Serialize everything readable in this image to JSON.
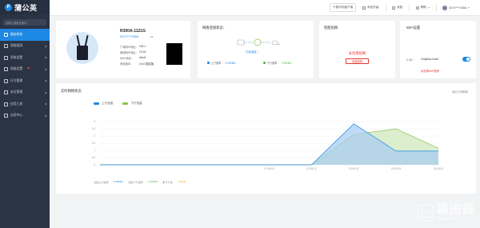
{
  "app": {
    "name": "蒲公英",
    "logo_letter": "P"
  },
  "sidebar": {
    "search_placeholder": "请输入搜索关键词",
    "items": [
      {
        "label": "路由状态",
        "icon": "dashboard-icon",
        "active": true
      },
      {
        "label": "智能组网",
        "icon": "network-icon"
      },
      {
        "label": "系统设置",
        "icon": "settings-icon"
      },
      {
        "label": "网络设置",
        "icon": "globe-icon",
        "badge": true
      },
      {
        "label": "行为管理",
        "icon": "behavior-icon"
      },
      {
        "label": "安全管理",
        "icon": "shield-icon"
      },
      {
        "label": "应用工具",
        "icon": "tools-icon"
      },
      {
        "label": "应用中心",
        "icon": "apps-icon"
      }
    ]
  },
  "topbar": {
    "download": "下载手机客户端",
    "settings": "系统升级",
    "notices": "消息",
    "help": "帮助",
    "user": "9270****2368"
  },
  "router": {
    "model": "R300A-1121G",
    "sn": "9270****2368",
    "sn_suffix": "- ar",
    "info": [
      {
        "label": "广域网IP地址：",
        "value": "192.1"
      },
      {
        "label": "局域网IP地址：",
        "value": "10.16"
      },
      {
        "label": "MAC地址：",
        "value": "a8:c8"
      },
      {
        "label": "系统版本：",
        "value": "4.6.0 稳定版"
      }
    ]
  },
  "connection": {
    "title": "网络连接状态：",
    "status": "已经连接 ！",
    "up_label": "上行速率：",
    "up_value": "0.00KB/s",
    "down_label": "下行速率：",
    "down_value": "7.59KB/s"
  },
  "smart": {
    "title": "智能组网",
    "status": "未创建组网",
    "button": "创建组网"
  },
  "wifi": {
    "title": "WiFi设置",
    "band": "2.4G：",
    "ssid": "OrayBox-D4e2",
    "enabled": true,
    "warning": "未设置WiFi密码"
  },
  "traffic": {
    "title": "实时网络状态",
    "link": "每五分钟刷新",
    "footer": {
      "up_label": "当前上行速率",
      "up_value": "0.00KB/s",
      "down_label": "当前下行速率",
      "down_value": "7.59KB/s",
      "total_label": "累计下载",
      "total_value": "7.45KB"
    }
  },
  "chart_data": {
    "type": "area",
    "title": "",
    "xlabel": "",
    "ylabel": "",
    "categories": [
      "",
      "",
      "",
      "",
      "22:05:03",
      "22:05:13",
      "22:05:23",
      "22:05:33",
      "22:05:43"
    ],
    "ylim": [
      0,
      3
    ],
    "yticks": [
      "0",
      "0.5",
      "1",
      "1.5",
      "2",
      "2.5",
      "3"
    ],
    "series": [
      {
        "name": "上行流量",
        "color": "#1e88e5",
        "fill": "#a9cdf0",
        "values": [
          0,
          0,
          0,
          0,
          0,
          0,
          2.85,
          0.95,
          0.95
        ]
      },
      {
        "name": "下行流量",
        "color": "#8bc34a",
        "fill": "#cfe8bd",
        "values": [
          0,
          0,
          0,
          0,
          0,
          0,
          2.1,
          2.5,
          1.15
        ]
      }
    ],
    "grid": true,
    "legend": "top-left"
  },
  "watermark": {
    "text": "路由器",
    "sub": "luyouqi.com"
  }
}
